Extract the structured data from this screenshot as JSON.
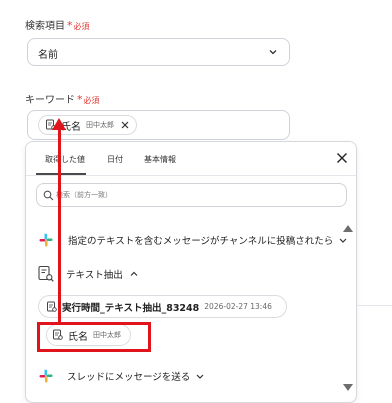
{
  "form": {
    "search_item": {
      "label": "検索項目",
      "required_mark": "*",
      "required_text": "必須",
      "value": "名前"
    },
    "keyword": {
      "label": "キーワード",
      "required_mark": "*",
      "required_text": "必須",
      "chip": {
        "name": "氏名",
        "sample": "田中太郎"
      }
    }
  },
  "dropdown": {
    "tabs": [
      "取得した値",
      "日付",
      "基本情報"
    ],
    "active_tab": 0,
    "search_placeholder": "検索（前方一致）",
    "items": {
      "slack_post": "指定のテキストを含むメッセージがチャンネルに投稿されたら",
      "text_extract": "テキスト抽出",
      "exec_time_name": "実行時間_テキスト抽出_83248",
      "exec_time_value": "2026-02-27 13:46",
      "field_name": "氏名",
      "field_sample": "田中太郎",
      "thread_send": "スレッドにメッセージを送る"
    }
  },
  "colors": {
    "required": "#e53935",
    "highlight": "#e0141a"
  }
}
